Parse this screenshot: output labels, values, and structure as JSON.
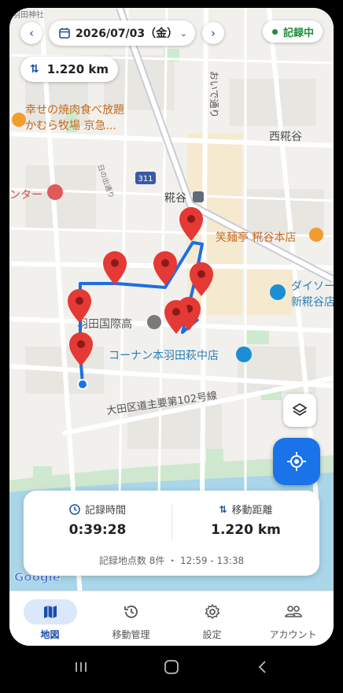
{
  "header": {
    "date_label": "2026/07/03（金）",
    "recording_status": "記録中",
    "distance_chip": "1.220 km"
  },
  "map_labels": {
    "restaurant_line1": "幸せの焼肉食べ放題",
    "restaurant_line2": "かむら牧場 京急...",
    "center_partial": "ンター",
    "station": "糀谷",
    "nishikojiya": "西糀谷",
    "ramen": "笑麺亭 糀谷本店",
    "daiso_line1": "ダイソー",
    "daiso_line2": "新糀谷店",
    "school": "羽田国際高",
    "konan": "コーナン本羽田萩中店",
    "road_name": "大田区道主要第102号線",
    "route_311": "311",
    "oi_dori": "おいで通り",
    "hi_dori": "日の出通り",
    "top_left_partial": "羽田神社",
    "google": "Google"
  },
  "colors": {
    "route": "#1e6fe0",
    "pin": "#e53935",
    "accent_blue": "#1a73e8",
    "recording_green": "#1e8e3e",
    "fab": "#1a73e8"
  },
  "card": {
    "time_label": "記録時間",
    "time_value": "0:39:28",
    "distance_label": "移動距離",
    "distance_value": "1.220 km",
    "footer": "記録地点数 8件 ・ 12:59 - 13:38"
  },
  "nav": {
    "items": [
      {
        "label": "地図",
        "icon": "map-icon",
        "active": true
      },
      {
        "label": "移動管理",
        "icon": "history-icon",
        "active": false
      },
      {
        "label": "設定",
        "icon": "gear-icon",
        "active": false
      },
      {
        "label": "アカウント",
        "icon": "people-icon",
        "active": false
      }
    ]
  }
}
